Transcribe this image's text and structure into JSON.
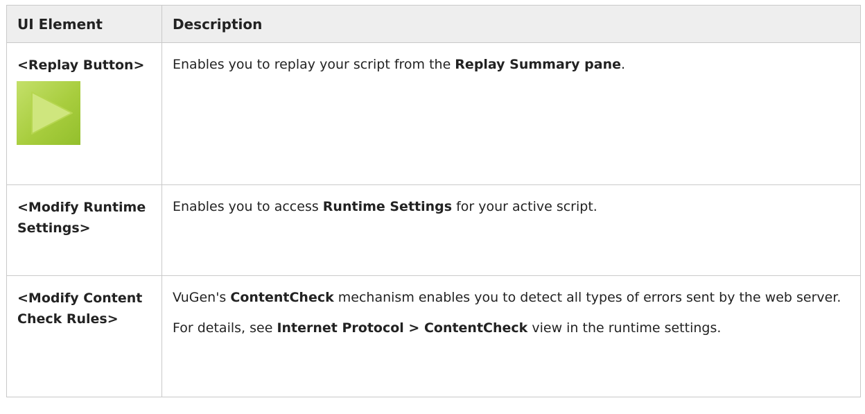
{
  "table": {
    "headers": [
      "UI Element",
      "Description"
    ],
    "rows": [
      {
        "element": "<Replay Button>",
        "icon": "play-icon",
        "description": [
          {
            "parts": [
              {
                "text": "Enables you to replay your script from the ",
                "bold": false
              },
              {
                "text": "Replay Summary pane",
                "bold": true
              },
              {
                "text": ".",
                "bold": false
              }
            ]
          }
        ]
      },
      {
        "element": "<Modify Runtime Settings>",
        "description": [
          {
            "parts": [
              {
                "text": "Enables you to access ",
                "bold": false
              },
              {
                "text": "Runtime Settings",
                "bold": true
              },
              {
                "text": " for your active script.",
                "bold": false
              }
            ]
          }
        ]
      },
      {
        "element": "<Modify Content Check Rules>",
        "description": [
          {
            "parts": [
              {
                "text": "VuGen's ",
                "bold": false
              },
              {
                "text": "ContentCheck",
                "bold": true
              },
              {
                "text": " mechanism enables you to detect all types of errors sent by the web server.",
                "bold": false
              }
            ]
          },
          {
            "parts": [
              {
                "text": "For details, see ",
                "bold": false
              },
              {
                "text": "Internet Protocol > ContentCheck",
                "bold": true
              },
              {
                "text": " view in the runtime settings.",
                "bold": false
              }
            ]
          }
        ]
      }
    ]
  },
  "colors": {
    "header_bg": "#eeeeee",
    "border": "#c9c9c9",
    "play_button": "#a8cd3e"
  }
}
